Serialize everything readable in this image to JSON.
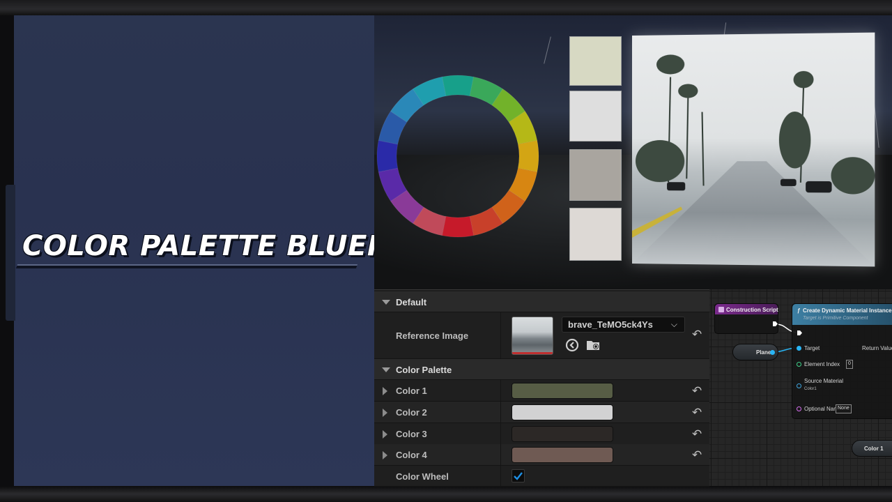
{
  "title": {
    "main": "COLOR PALETTE BLUEPRINT"
  },
  "viewport": {
    "color_wheel_segments": [
      "#17a08a",
      "#3aa85a",
      "#72b22a",
      "#b5b817",
      "#d3a514",
      "#d78612",
      "#d0621a",
      "#c8402a",
      "#c61a2a",
      "#c04a5a",
      "#8a3a98",
      "#5a2aa8",
      "#2a2aa8",
      "#2a5aa8",
      "#2a88b8",
      "#1f9eae"
    ],
    "swatches": [
      "#d7d9c3",
      "#dedede",
      "#a9a59f",
      "#ddd9d5"
    ]
  },
  "details": {
    "default_category": "Default",
    "reference_image_label": "Reference Image",
    "reference_image_asset": "brave_TeMO5ck4Ys",
    "color_palette_category": "Color Palette",
    "colors": [
      {
        "label": "Color 1",
        "value": "#575d45"
      },
      {
        "label": "Color 2",
        "value": "#d2d2d3"
      },
      {
        "label": "Color 3",
        "value": "#2c2826"
      },
      {
        "label": "Color 4",
        "value": "#6f5a53"
      }
    ],
    "color_wheel_label": "Color Wheel",
    "color_wheel_checked": true,
    "reset_glyph": "↶",
    "chevron_glyph": "⌵"
  },
  "graph": {
    "construction_script_title": "Construction Script",
    "create_node_title": "Create Dynamic Material Instance",
    "create_node_subtitle": "Target is Primitive Component",
    "target_label": "Target",
    "return_value_label": "Return Value",
    "element_index_label": "Element Index",
    "element_index_value": "0",
    "source_material_label": "Source Material",
    "source_material_value": "Color1",
    "optional_name_label": "Optional Name",
    "optional_name_value": "None",
    "plane_label": "Plane",
    "color1_label": "Color 1"
  }
}
